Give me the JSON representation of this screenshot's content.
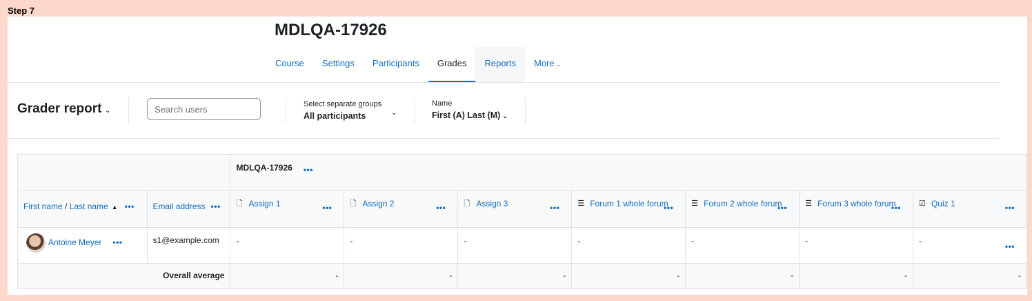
{
  "step_label": "Step 7",
  "course": {
    "title": "MDLQA-17926",
    "nav": [
      "Course",
      "Settings",
      "Participants",
      "Grades",
      "Reports",
      "More"
    ]
  },
  "report": {
    "title": "Grader report",
    "search_placeholder": "Search users",
    "group_label": "Select separate groups",
    "group_value": "All participants",
    "name_label": "Name",
    "name_value": "First (A) Last (M)"
  },
  "table": {
    "category": "MDLQA-17926",
    "col_firstname": "First name",
    "col_sep": " / ",
    "col_lastname": "Last name",
    "col_email": "Email address",
    "items": [
      {
        "name": "Assign 1",
        "icon": "assign-icon"
      },
      {
        "name": "Assign 2",
        "icon": "assign-icon"
      },
      {
        "name": "Assign 3",
        "icon": "assign-icon"
      },
      {
        "name": "Forum 1 whole forum",
        "icon": "forum-icon"
      },
      {
        "name": "Forum 2 whole forum",
        "icon": "forum-icon"
      },
      {
        "name": "Forum 3 whole forum",
        "icon": "forum-icon"
      },
      {
        "name": "Quiz 1",
        "icon": "quiz-icon"
      }
    ],
    "rows": [
      {
        "name": "Antoine Meyer",
        "email": "s1@example.com",
        "grades": [
          "-",
          "-",
          "-",
          "-",
          "-",
          "-",
          "-"
        ]
      }
    ],
    "avg_label": "Overall average",
    "avgs": [
      "-",
      "-",
      "-",
      "-",
      "-",
      "-",
      "-"
    ]
  }
}
